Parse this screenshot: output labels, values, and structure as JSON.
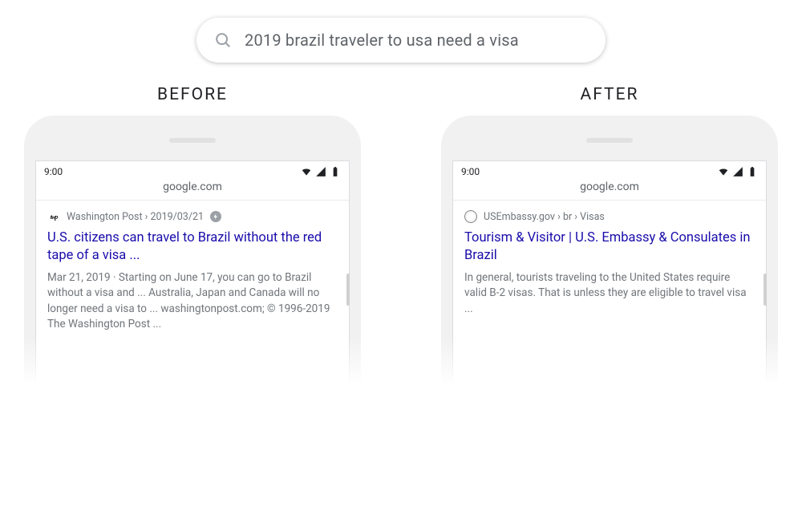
{
  "search": {
    "query": "2019 brazil traveler to usa need a visa"
  },
  "headings": {
    "before": "BEFORE",
    "after": "AFTER"
  },
  "statusbar": {
    "time": "9:00",
    "url": "google.com"
  },
  "before": {
    "favicon_text": "twp",
    "breadcrumb": "Washington Post › 2019/03/21",
    "has_amp": true,
    "title": "U.S. citizens can travel to Brazil without the red tape of a visa ...",
    "snippet_date": "Mar 21, 2019",
    "snippet": " · Starting on June 17, you can go to Brazil without a visa and ... Australia, Japan and Canada will no longer need a visa to ... washingtonpost.com; © 1996-2019 The Washington Post ..."
  },
  "after": {
    "breadcrumb": "USEmbassy.gov › br › Visas",
    "title": "Tourism & Visitor | U.S. Embassy & Consulates in Brazil",
    "snippet": "In general, tourists traveling to the United States require valid B-2 visas. That is unless they are eligible to travel visa ..."
  }
}
